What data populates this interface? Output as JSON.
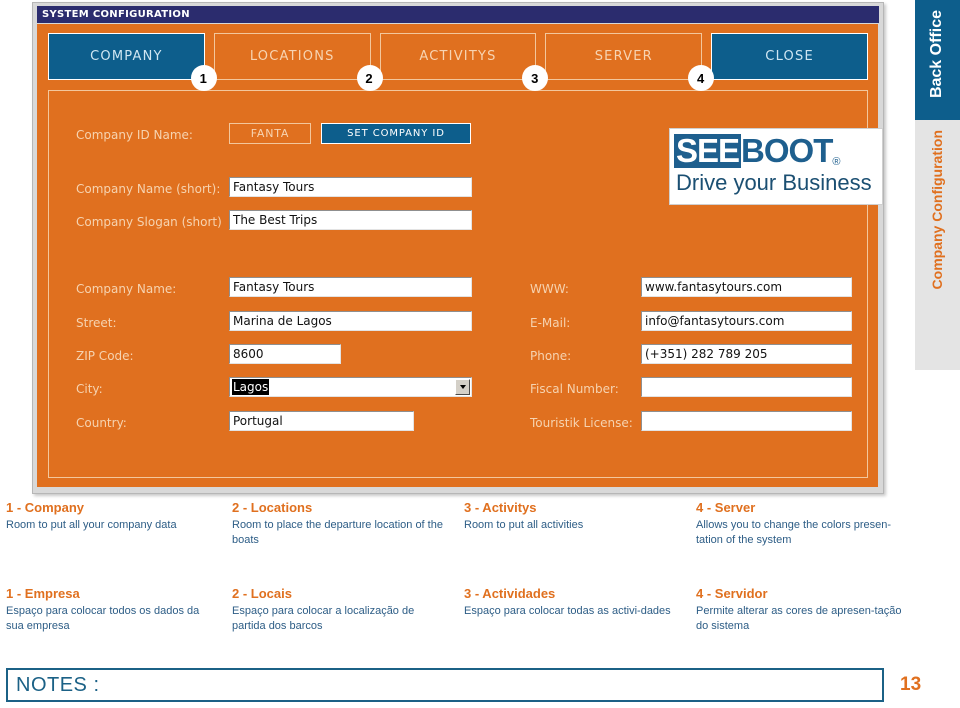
{
  "window": {
    "title": "SYSTEM CONFIGURATION",
    "tabs": [
      {
        "label": "COMPANY",
        "badge": "1",
        "selected": true
      },
      {
        "label": "LOCATIONS",
        "badge": "2",
        "selected": false
      },
      {
        "label": "ACTIVITYS",
        "badge": "3",
        "selected": false
      },
      {
        "label": "SERVER",
        "badge": "4",
        "selected": false
      },
      {
        "label": "CLOSE",
        "badge": "",
        "selected": true
      }
    ],
    "form": {
      "company_id_label": "Company ID Name:",
      "company_id_value": "FANTA",
      "set_company_id_button": "SET COMPANY ID",
      "company_name_short_label": "Company Name (short):",
      "company_name_short_value": "Fantasy Tours",
      "company_slogan_short_label": "Company Slogan (short)",
      "company_slogan_short_value": "The Best Trips",
      "company_name_label": "Company Name:",
      "company_name_value": "Fantasy Tours",
      "street_label": "Street:",
      "street_value": "Marina de Lagos",
      "zip_label": "ZIP Code:",
      "zip_value": "8600",
      "city_label": "City:",
      "city_value": "Lagos",
      "country_label": "Country:",
      "country_value": "Portugal",
      "www_label": "WWW:",
      "www_value": "www.fantasytours.com",
      "email_label": "E-Mail:",
      "email_value": "info@fantasytours.com",
      "phone_label": "Phone:",
      "phone_value": "(+351) 282 789 205",
      "fiscal_label": "Fiscal Number:",
      "fiscal_value": "",
      "touristik_label": "Touristik License:",
      "touristik_value": ""
    },
    "logo": {
      "part_one": "SEE",
      "part_two": "BOOT",
      "registered": "®",
      "tagline": "Drive your Business"
    }
  },
  "side_tabs": [
    {
      "label": "Back Office"
    },
    {
      "label": "Company Configuration"
    }
  ],
  "captions_en": [
    {
      "heading": "1 - Company",
      "body": "Room to put all your company data"
    },
    {
      "heading": "2 -  Locations",
      "body": "Room to place the departure location of the boats"
    },
    {
      "heading": "3 - Activitys",
      "body": "Room to put all activities"
    },
    {
      "heading": "4 - Server",
      "body": "Allows you to change the colors presen-tation of the system"
    }
  ],
  "captions_pt": [
    {
      "heading": "1 - Empresa",
      "body": "Espaço para colocar todos os dados da sua empresa"
    },
    {
      "heading": "2 - Locais",
      "body": "Espaço para colocar a localização de partida dos barcos"
    },
    {
      "heading": "3 - Actividades",
      "body": "Espaço para colocar todas as activi-dades"
    },
    {
      "heading": "4 - Servidor",
      "body": "Permite alterar as cores de apresen-tação do sistema"
    }
  ],
  "footer": {
    "notes_label": "NOTES :",
    "page_number": "13"
  },
  "colors": {
    "orange": "#e0701f",
    "blue": "#0d5e8c",
    "navy": "#2b2c6e",
    "body_text": "#2d5d86"
  }
}
